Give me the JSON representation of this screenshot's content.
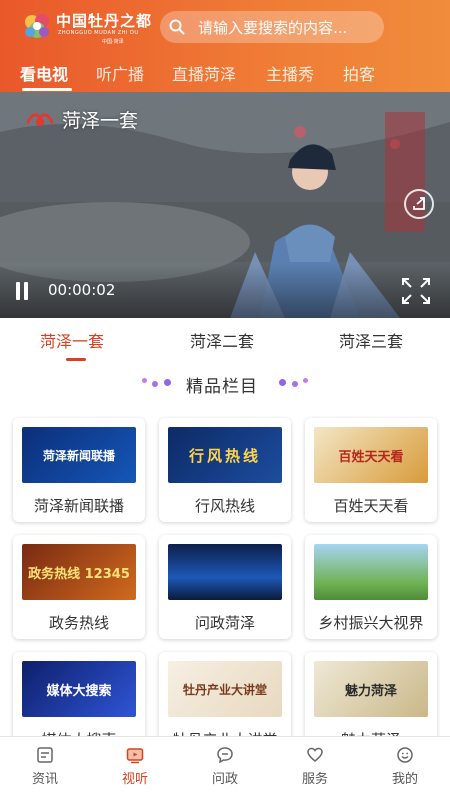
{
  "header": {
    "logo_text": "中国牡丹之都",
    "logo_sub": "ZHONGGUO MUDAN ZHI DU",
    "logo_sub2": "中国·菏泽",
    "search_placeholder": "请输入要搜索的内容..."
  },
  "top_tabs": [
    {
      "label": "看电视",
      "active": true
    },
    {
      "label": "听广播",
      "active": false
    },
    {
      "label": "直播菏泽",
      "active": false
    },
    {
      "label": "主播秀",
      "active": false
    },
    {
      "label": "拍客",
      "active": false
    }
  ],
  "player": {
    "channel_name": "菏泽一套",
    "time": "00:00:02"
  },
  "channel_tabs": [
    {
      "label": "菏泽一套",
      "active": true
    },
    {
      "label": "菏泽二套",
      "active": false
    },
    {
      "label": "菏泽三套",
      "active": false
    }
  ],
  "section_title": "精品栏目",
  "programs": [
    {
      "label": "菏泽新闻联播",
      "thumb_text": "菏泽新闻联播"
    },
    {
      "label": "行风热线",
      "thumb_text": "行风热线"
    },
    {
      "label": "百姓天天看",
      "thumb_text": "百姓天天看"
    },
    {
      "label": "政务热线",
      "thumb_text": "政务热线 12345"
    },
    {
      "label": "问政菏泽",
      "thumb_text": ""
    },
    {
      "label": "乡村振兴大视界",
      "thumb_text": ""
    },
    {
      "label": "媒体大搜索",
      "thumb_text": "媒体大搜索"
    },
    {
      "label": "牡丹产业大讲堂",
      "thumb_text": "牡丹产业大讲堂"
    },
    {
      "label": "魅力菏泽",
      "thumb_text": "魅力菏泽"
    }
  ],
  "bottom_nav": [
    {
      "label": "资讯",
      "icon": "news-icon",
      "active": false
    },
    {
      "label": "视听",
      "icon": "tv-icon",
      "active": true
    },
    {
      "label": "问政",
      "icon": "chat-icon",
      "active": false
    },
    {
      "label": "服务",
      "icon": "heart-icon",
      "active": false
    },
    {
      "label": "我的",
      "icon": "user-icon",
      "active": false
    }
  ],
  "colors": {
    "brand_gradient_start": "#e9582a",
    "brand_gradient_end": "#f08c3c",
    "accent": "#d4421f"
  }
}
